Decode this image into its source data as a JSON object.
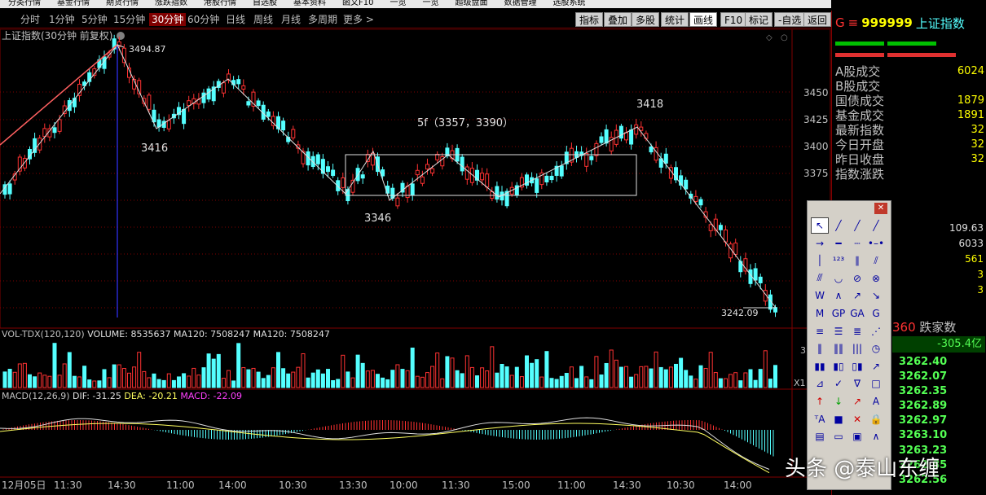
{
  "top_menu": [
    "分类行情",
    "基金行情",
    "期货行情",
    "涨跌指数",
    "港股行情",
    "自选股",
    "基本资料",
    "函文F10",
    "一览",
    "一览",
    "超级盘面",
    "数据管理",
    "选股系统"
  ],
  "period_tabs": [
    "分时",
    "1分钟",
    "5分钟",
    "15分钟",
    "30分钟",
    "60分钟",
    "日线",
    "周线",
    "月线",
    "多周期",
    "更多 >"
  ],
  "active_period": "30分钟",
  "right_buttons": [
    "指标",
    "叠加",
    "多股",
    "统计",
    "画线",
    "F10",
    "标记",
    "-自选",
    "返回"
  ],
  "active_right_button": "画线",
  "main_chart": {
    "title": "上证指数(30分钟 前复权)",
    "y_ticks": [
      "3450",
      "3425",
      "3400",
      "3375"
    ],
    "annotations": {
      "high": "3494.87",
      "a": "3416",
      "b": "3346",
      "c": "3418",
      "box": "5f（3357，3390）",
      "low": "3242.09"
    }
  },
  "volume_pane": {
    "label": "VOL-TDX(120,120)",
    "volume": "VOLUME: 8535637",
    "ma1": "MA120: 7508247",
    "ma2": "MA120: 7508247",
    "scale_top": "3",
    "scale_unit": "X1"
  },
  "macd_pane": {
    "label": "MACD(12,26,9)",
    "dif": "DIF: -31.25",
    "dea": "DEA: -20.21",
    "macd": "MACD: -22.09"
  },
  "x_axis": [
    "12月05日",
    "11:30",
    "14:30",
    "11:00",
    "14:00",
    "10:30",
    "13:30",
    "10:00",
    "11:30",
    "15:00",
    "11:00",
    "14:30",
    "10:30",
    "14:00"
  ],
  "right_panel": {
    "code": "999999",
    "name": "上证指数",
    "flag": "G",
    "rows": [
      {
        "label": "A股成交",
        "value": "6024"
      },
      {
        "label": "B股成交",
        "value": ""
      },
      {
        "label": "国债成交",
        "value": "1879"
      },
      {
        "label": "基金成交",
        "value": "1891"
      },
      {
        "label": "最新指数",
        "value": "32"
      },
      {
        "label": "今日开盘",
        "value": "32"
      },
      {
        "label": "昨日收盘",
        "value": "32"
      },
      {
        "label": "指数涨跌",
        "value": ""
      }
    ],
    "extra_values": [
      "109.63",
      "6033",
      "561",
      "3",
      "3"
    ],
    "fall_count_label": "跌家数",
    "fall_count": "360",
    "change": "-305.4亿",
    "ticks": [
      "3262.40",
      "3262.07",
      "3262.35",
      "3262.89",
      "3262.97",
      "3263.10",
      "3263.23",
      "3262.85",
      "3262.56"
    ]
  },
  "toolbox": {
    "tools": [
      "cursor",
      "line",
      "ray",
      "segment",
      "arrow",
      "hline",
      "dot-line",
      "endpoints",
      "vline",
      "num-line",
      "parallel",
      "channel",
      "fib-line",
      "arc",
      "circle",
      "circle-cross",
      "wave-w",
      "wave-zigzag",
      "wave-up",
      "wave-down",
      "wave-m",
      "gp",
      "ga",
      "g",
      "fib-h",
      "text-lines",
      "multi-h",
      "fan",
      "v-lines",
      "v-lines2",
      "v-lines3",
      "cycle",
      "bars",
      "bars2",
      "bars3",
      "trend",
      "fan2",
      "check",
      "triangle",
      "rect",
      "up-arrow",
      "down-arrow",
      "red-arrow",
      "text-a",
      "ta",
      "square",
      "cross-x",
      "lock",
      "doc",
      "tape",
      "image",
      "curve"
    ]
  },
  "watermark": "头条 @泰山东缠",
  "colors": {
    "up": "#ff3232",
    "down": "#54ffff",
    "bg": "#000000",
    "grid": "#800000",
    "highlight": "#ffff00"
  }
}
